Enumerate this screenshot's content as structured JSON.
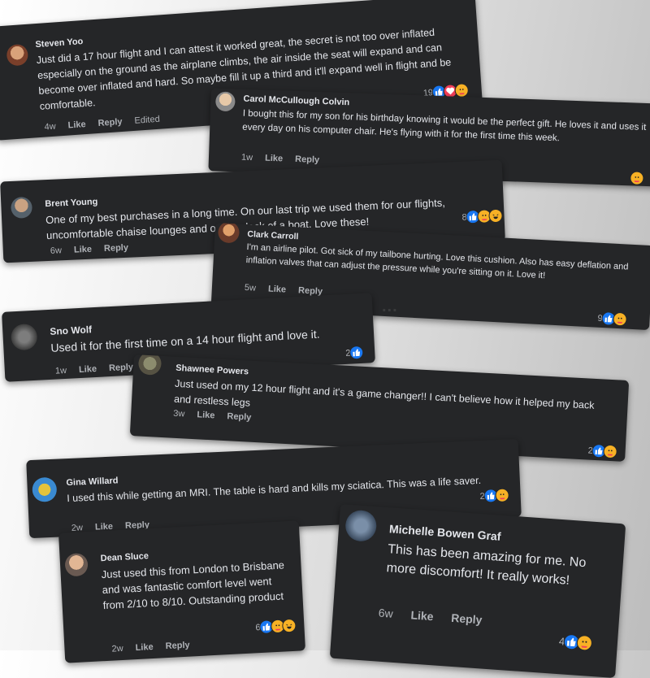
{
  "comments": [
    {
      "name": "Steven Yoo",
      "text": "Just did a 17 hour flight and I can attest it worked great, the secret is not too over inflated especially on the ground as the airplane climbs, the air inside the seat will expand and can become over inflated and hard. So maybe fill it up a third and it'll expand well in flight and be comfortable.",
      "time": "4w",
      "like": "Like",
      "reply": "Reply",
      "edited": "Edited",
      "count": "19",
      "reactions": [
        "like",
        "love",
        "care"
      ]
    },
    {
      "name": "Carol McCullough Colvin",
      "text": "I bought this for my son for his birthday knowing it would be the perfect gift. He loves it and uses it every day on his computer chair. He's flying with it for the first time this week.",
      "time": "1w",
      "like": "Like",
      "reply": "Reply",
      "count": "",
      "reactions": [
        "care"
      ]
    },
    {
      "name": "Brent Young",
      "text": "One of my best purchases in a long time. On our last trip we used them for our flights, uncomfortable chaise lounges and on the deck of a boat. Love these!",
      "time": "6w",
      "like": "Like",
      "reply": "Reply",
      "count": "8",
      "reactions": [
        "like",
        "care",
        "haha"
      ]
    },
    {
      "name": "Clark Carroll",
      "text": "I'm an airline pilot. Got sick of my tailbone hurting. Love this cushion. Also has easy deflation and inflation valves that can adjust the pressure while you're sitting on it. Love it!",
      "time": "5w",
      "like": "Like",
      "reply": "Reply",
      "count": "9",
      "reactions": [
        "like",
        "care"
      ]
    },
    {
      "name": "Sno Wolf",
      "text": "Used it for the first time on a 14 hour flight and love it.",
      "time": "1w",
      "like": "Like",
      "reply": "Reply",
      "count": "2",
      "reactions": [
        "like"
      ]
    },
    {
      "name": "Shawnee Powers",
      "text": "Just used on my 12 hour flight and it's a game changer!! I can't believe how it helped my back and restless legs",
      "time": "3w",
      "like": "Like",
      "reply": "Reply",
      "count": "2",
      "reactions": [
        "like",
        "care"
      ]
    },
    {
      "name": "Gina Willard",
      "text": "I used this while getting an MRI. The table is hard and kills my sciatica. This was a life saver.",
      "time": "2w",
      "like": "Like",
      "reply": "Reply",
      "count": "2",
      "reactions": [
        "like",
        "care"
      ]
    },
    {
      "name": "Dean Sluce",
      "text": "Just used this from London to Brisbane and was fantastic comfort level went from 2/10 to 8/10. Outstanding product",
      "time": "2w",
      "like": "Like",
      "reply": "Reply",
      "count": "6",
      "reactions": [
        "like",
        "care",
        "haha"
      ]
    },
    {
      "name": "Michelle Bowen Graf",
      "text": "This has been amazing for me. No more discomfort! It really works!",
      "time": "6w",
      "like": "Like",
      "reply": "Reply",
      "count": "4",
      "reactions": [
        "like",
        "care"
      ]
    }
  ],
  "more_options": "...",
  "colors": {
    "card_bg": "#252628",
    "text": "#e4e6eb",
    "muted": "#b0b3b8",
    "like_blue": "#1877f2",
    "love_red": "#f33e58",
    "care_yellow": "#f7b125"
  }
}
